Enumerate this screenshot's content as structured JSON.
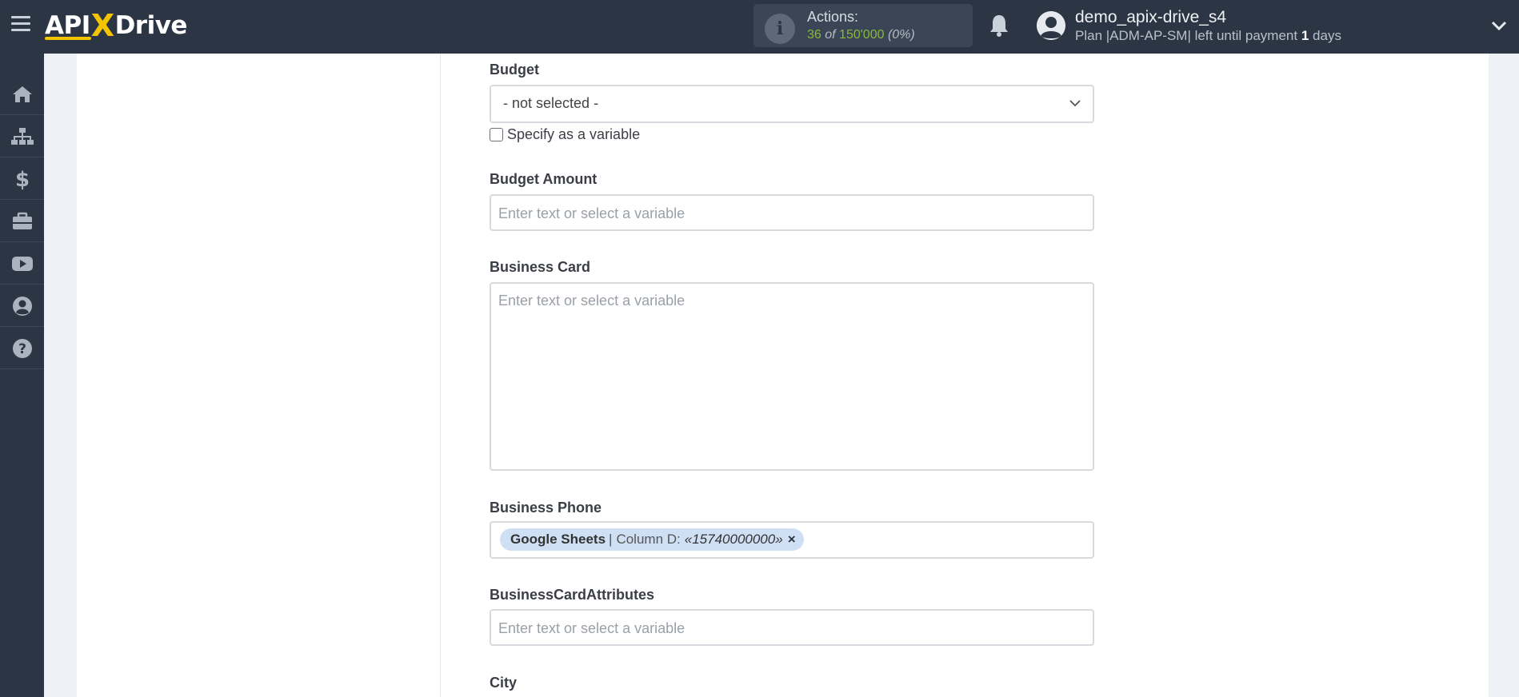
{
  "header": {
    "logo": {
      "left": "API",
      "x": "X",
      "right": "Drive"
    },
    "actions": {
      "label": "Actions:",
      "used": "36",
      "of": "of",
      "limit": "150'000",
      "percent": "(0%)"
    },
    "user": {
      "name": "demo_apix-drive_s4",
      "plan_prefix": "Plan |ADM-AP-SM| left until payment",
      "days_count": "1",
      "days_suffix": "days"
    },
    "colors": {
      "topbar": "#2c3544",
      "accent": "#f5c400",
      "actions_green": "#8ab93a"
    }
  },
  "sidebar": {
    "items": [
      {
        "icon": "home-icon"
      },
      {
        "icon": "sitemap-icon"
      },
      {
        "icon": "dollar-icon"
      },
      {
        "icon": "briefcase-icon"
      },
      {
        "icon": "youtube-icon"
      },
      {
        "icon": "user-circle-icon"
      },
      {
        "icon": "question-circle-icon"
      }
    ]
  },
  "form": {
    "budget": {
      "label": "Budget",
      "value": "- not selected -",
      "checkbox_label": "Specify as a variable",
      "checked": false
    },
    "budget_amount": {
      "label": "Budget Amount",
      "placeholder": "Enter text or select a variable"
    },
    "business_card": {
      "label": "Business Card",
      "placeholder": "Enter text or select a variable"
    },
    "business_phone": {
      "label": "Business Phone",
      "tag": {
        "source": "Google Sheets",
        "separator": "|",
        "column": "Column D:",
        "value": "«15740000000»",
        "remove": "×"
      }
    },
    "business_card_attributes": {
      "label": "BusinessCardAttributes",
      "placeholder": "Enter text or select a variable"
    },
    "city": {
      "label": "City"
    }
  }
}
